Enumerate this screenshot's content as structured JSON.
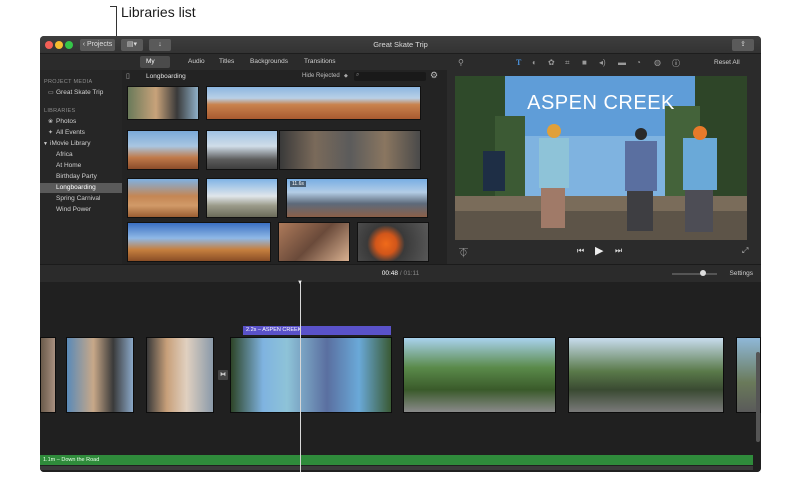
{
  "callout": {
    "label": "Libraries list"
  },
  "window": {
    "title": "Great Skate Trip"
  },
  "toolbar": {
    "projects_label": "Projects"
  },
  "tabs": [
    {
      "label": "My Media",
      "active": true
    },
    {
      "label": "Audio",
      "active": false
    },
    {
      "label": "Titles",
      "active": false
    },
    {
      "label": "Backgrounds",
      "active": false
    },
    {
      "label": "Transitions",
      "active": false
    }
  ],
  "sidebar": {
    "project_media_heading": "PROJECT MEDIA",
    "project_item": "Great Skate Trip",
    "libraries_heading": "LIBRARIES",
    "photos": "Photos",
    "all_events": "All Events",
    "library": "iMovie Library",
    "events": [
      "Africa",
      "At Home",
      "Birthday Party",
      "Longboarding",
      "Spring Carnival",
      "Wind Power"
    ],
    "selected": "Longboarding"
  },
  "browser": {
    "title": "Longboarding",
    "filter": "Hide Rejected",
    "duration_badge": "11.6s"
  },
  "viewer": {
    "title_overlay": "ASPEN CREEK",
    "reset_label": "Reset All"
  },
  "timeline": {
    "current_time": "00:48",
    "separator": "/",
    "total_time": "01:11",
    "settings_label": "Settings",
    "title_clip": "2.2s – ASPEN CREEK",
    "audio_clip": "1.1m – Down the Road"
  },
  "colors": {
    "title_clip": "#5a52c9",
    "audio_track": "#2f8b3b",
    "selection": "#5a5a5a"
  }
}
